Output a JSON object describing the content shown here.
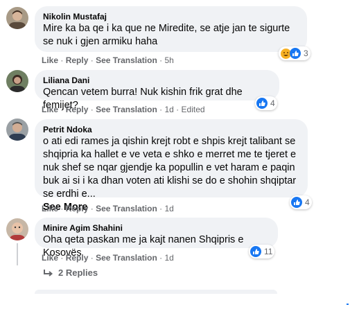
{
  "comments": [
    {
      "author": "Nikolin Mustafaj",
      "text": "Mire ka ba qe i ka que ne Miredite, se atje jan te sigurte se nuk i gjen armiku haha",
      "like_label": "Like",
      "reply_label": "Reply",
      "translate_label": "See Translation",
      "time": "5h",
      "reaction_count": "3"
    },
    {
      "author": "Liliana Dani",
      "text": "Qencan vetem burra! Nuk kishin frik grat dhe femijet?",
      "like_label": "Like",
      "reply_label": "Reply",
      "translate_label": "See Translation",
      "time": "1d",
      "edited": "Edited",
      "reaction_count": "4"
    },
    {
      "author": "Petrit Ndoka",
      "text": "o ati edi rames ja qishin krejt robt e shpis krejt talibant se shqipria ka hallet e ve veta e shko e merret me te tjeret e nuk shef se nqar gjendje ka popullin e vet haram e paqin buk ai si i ka dhan voten ati klishi se do e shohin shqiptar se erdhi e...",
      "see_more": "See More",
      "like_label": "Like",
      "reply_label": "Reply",
      "translate_label": "See Translation",
      "time": "1d",
      "reaction_count": "4"
    },
    {
      "author": "Minire Agim Shahini",
      "text": "Oha qeta paskan me ja kajt nanen Shqipris e Kosovës",
      "like_label": "Like",
      "reply_label": "Reply",
      "translate_label": "See Translation",
      "time": "1d",
      "reaction_count": "11"
    }
  ],
  "replies_label": "2 Replies",
  "separator": "·",
  "colors": {
    "bubble": "#f0f2f5",
    "meta_text": "#65676b",
    "like_blue": "#1877f2",
    "haha_yellow": "#f7b125"
  }
}
